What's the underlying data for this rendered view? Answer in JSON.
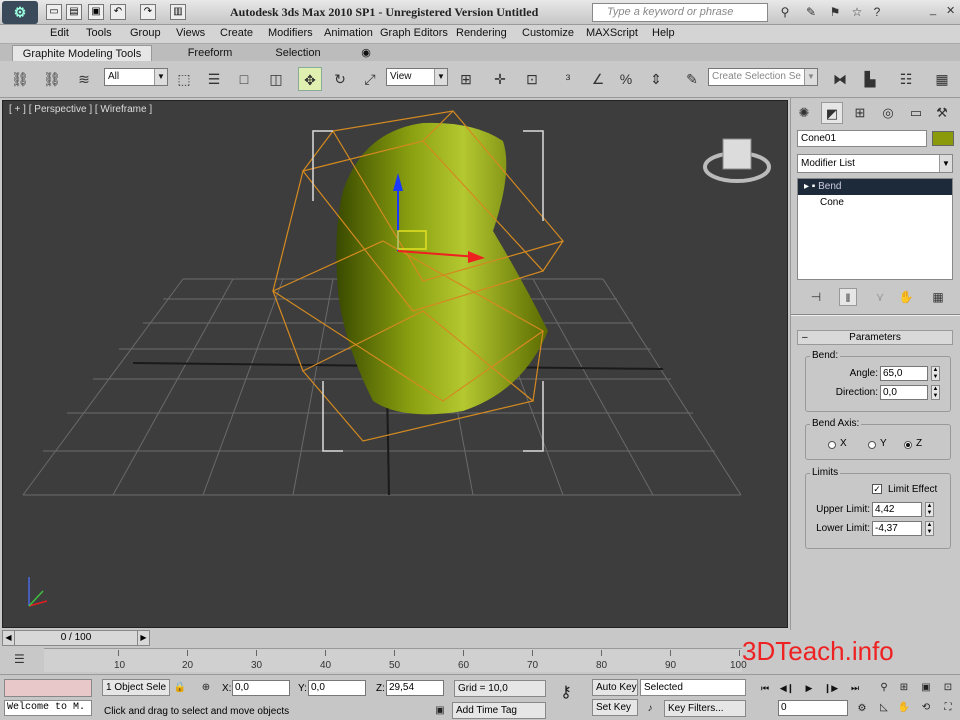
{
  "titlebar": {
    "title": "Autodesk 3ds Max  2010 SP1  -  Unregistered Version    Untitled",
    "search_placeholder": "Type a keyword or phrase",
    "window_controls": [
      "_",
      "✕"
    ]
  },
  "menu": [
    "Edit",
    "Tools",
    "Group",
    "Views",
    "Create",
    "Modifiers",
    "Animation",
    "Graph Editors",
    "Rendering",
    "Customize",
    "MAXScript",
    "Help"
  ],
  "ribbon_tabs": [
    "Graphite Modeling Tools",
    "Freeform",
    "Selection"
  ],
  "toolbar": {
    "selection_filter": "All",
    "ref_coord": "View",
    "named_selection_placeholder": "Create Selection Se"
  },
  "viewport": {
    "label": "[ + ] [ Perspective ] [ Wireframe ]"
  },
  "command_panel": {
    "object_name": "Cone01",
    "object_color": "#8a9a0a",
    "modifier_list": "Modifier List",
    "stack": [
      "Bend",
      "Cone"
    ],
    "rollout_title": "Parameters",
    "bend": {
      "label": "Bend:",
      "angle_label": "Angle:",
      "angle_value": "65,0",
      "direction_label": "Direction:",
      "direction_value": "0,0"
    },
    "bend_axis": {
      "label": "Bend Axis:",
      "options": [
        "X",
        "Y",
        "Z"
      ],
      "selected": "Z"
    },
    "limits": {
      "label": "Limits",
      "limit_effect_label": "Limit Effect",
      "limit_effect_checked": true,
      "upper_label": "Upper Limit:",
      "upper_value": "4,42",
      "lower_label": "Lower Limit:",
      "lower_value": "-4,37"
    }
  },
  "timeline": {
    "slider_text": "0 / 100",
    "ticks": [
      "10",
      "20",
      "30",
      "40",
      "50",
      "60",
      "70",
      "80",
      "90",
      "100"
    ]
  },
  "status": {
    "maxscript_text": "Welcome to M.",
    "selection_count": "1 Object Sele",
    "prompt": "Click and drag to select and move objects",
    "x_label": "X:",
    "x_value": "0,0",
    "y_label": "Y:",
    "y_value": "0,0",
    "z_label": "Z:",
    "z_value": "29,54",
    "grid": "Grid = 10,0",
    "add_time_tag": "Add Time Tag",
    "auto_key": "Auto Key",
    "set_key": "Set Key",
    "key_mode": "Selected",
    "key_filters": "Key Filters...",
    "frame_value": "0"
  },
  "watermark": "3DTeach.info"
}
